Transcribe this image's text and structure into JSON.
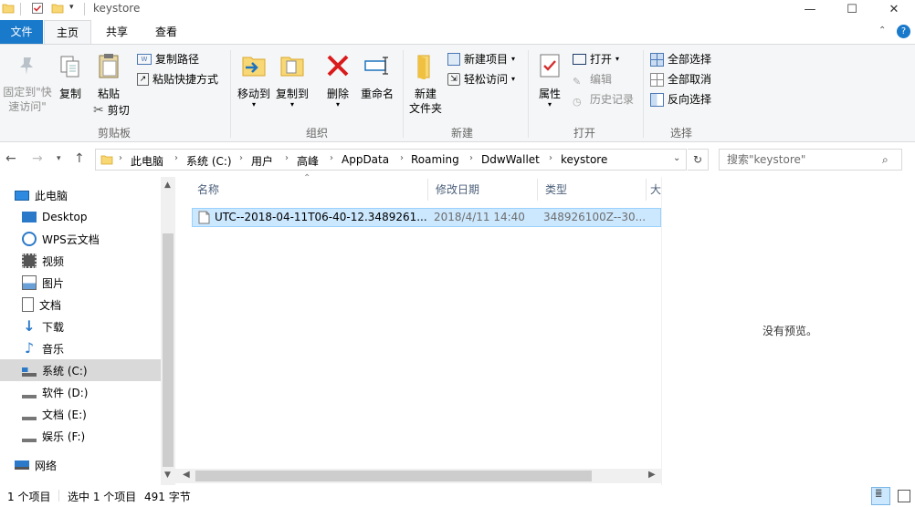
{
  "window": {
    "title": "keystore",
    "minimize": "—",
    "maximize": "☐",
    "close": "✕"
  },
  "tabs": {
    "file": "文件",
    "home": "主页",
    "share": "共享",
    "view": "查看"
  },
  "ribbon": {
    "pin_quick_access": "固定到\"快\n速访问\"",
    "pin_line1": "固定到\"快",
    "pin_line2": "速访问\"",
    "copy": "复制",
    "paste": "粘贴",
    "copy_path": "复制路径",
    "paste_shortcut": "粘贴快捷方式",
    "cut": "剪切",
    "clipboard_group": "剪贴板",
    "move_to": "移动到",
    "copy_to": "复制到",
    "delete": "删除",
    "rename": "重命名",
    "organize_group": "组织",
    "new_folder_line1": "新建",
    "new_folder_line2": "文件夹",
    "new_item": "新建项目",
    "easy_access": "轻松访问",
    "new_group": "新建",
    "properties": "属性",
    "open": "打开",
    "edit": "编辑",
    "history": "历史记录",
    "open_group": "打开",
    "select_all": "全部选择",
    "select_none": "全部取消",
    "invert_selection": "反向选择",
    "select_group": "选择"
  },
  "address": {
    "crumbs": [
      "此电脑",
      "系统 (C:)",
      "用户",
      "高峰",
      "AppData",
      "Roaming",
      "DdwWallet",
      "keystore"
    ],
    "search_placeholder": "搜索\"keystore\""
  },
  "nav": {
    "items": [
      {
        "label": "此电脑",
        "icon": "pc-icon"
      },
      {
        "label": "Desktop",
        "icon": "desktop-icon"
      },
      {
        "label": "WPS云文档",
        "icon": "cloud-icon"
      },
      {
        "label": "视频",
        "icon": "video-icon"
      },
      {
        "label": "图片",
        "icon": "picture-icon"
      },
      {
        "label": "文档",
        "icon": "document-icon"
      },
      {
        "label": "下载",
        "icon": "download-icon"
      },
      {
        "label": "音乐",
        "icon": "music-icon"
      },
      {
        "label": "系统 (C:)",
        "icon": "drive-icon"
      },
      {
        "label": "软件 (D:)",
        "icon": "drive-icon"
      },
      {
        "label": "文档 (E:)",
        "icon": "drive-icon"
      },
      {
        "label": "娱乐 (F:)",
        "icon": "drive-icon"
      },
      {
        "label": "网络",
        "icon": "network-icon"
      }
    ]
  },
  "list": {
    "columns": [
      "名称",
      "修改日期",
      "类型",
      "大"
    ],
    "rows": [
      {
        "name": "UTC--2018-04-11T06-40-12.3489261...",
        "date": "2018/4/11 14:40",
        "type": "348926100Z--30..."
      }
    ]
  },
  "preview": {
    "empty_text": "没有预览。"
  },
  "status": {
    "item_count": "1 个项目",
    "selected": "选中 1 个项目",
    "size": "491 字节"
  },
  "colors": {
    "accent": "#1979ca",
    "selection": "#cce8ff",
    "selection_border": "#99d1ff"
  }
}
